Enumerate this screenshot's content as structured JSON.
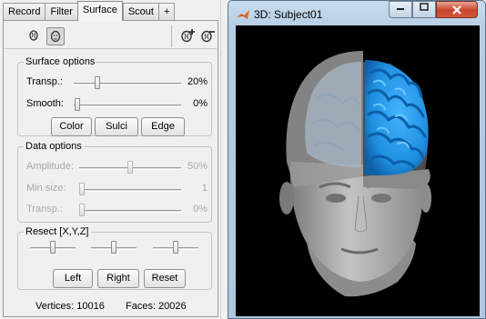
{
  "tabs": [
    {
      "label": "Record"
    },
    {
      "label": "Filter"
    },
    {
      "label": "Surface"
    },
    {
      "label": "Scout"
    },
    {
      "label": "+"
    }
  ],
  "surface_options": {
    "title": "Surface options",
    "transparency": {
      "label": "Transp.:",
      "value": "20%",
      "level": 0.2
    },
    "smooth": {
      "label": "Smooth:",
      "value": "0%",
      "level": 0.0
    },
    "buttons": {
      "color": "Color",
      "sulci": "Sulci",
      "edge": "Edge"
    }
  },
  "data_options": {
    "title": "Data options",
    "amplitude": {
      "label": "Amplitude:",
      "value": "50%",
      "level": 0.5
    },
    "min_size": {
      "label": "Min size:",
      "value": "1",
      "level": 0.0
    },
    "transparency": {
      "label": "Transp.:",
      "value": "0%",
      "level": 0.0
    }
  },
  "resect": {
    "title": "Resect [X,Y,Z]",
    "sliders": [
      0.5,
      0.5,
      0.5
    ],
    "buttons": {
      "left": "Left",
      "right": "Right",
      "reset": "Reset"
    }
  },
  "status": {
    "vertices": "Vertices: 10016",
    "faces": "Faces: 20026"
  },
  "window": {
    "title": "3D: Subject01",
    "close_label": "x"
  },
  "colors": {
    "cortex_blue": "#1f8fe0",
    "head_gray": "#9a9a9a",
    "viewport_bg": "#000000"
  }
}
